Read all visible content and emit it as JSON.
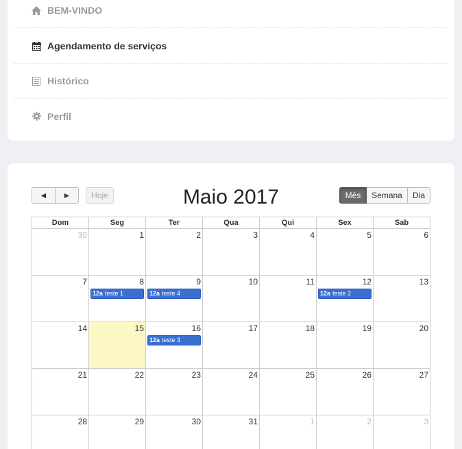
{
  "menu": {
    "items": [
      {
        "label": "BEM-VINDO",
        "icon": "home-icon"
      },
      {
        "label": "Agendamento de serviços",
        "icon": "calendar-icon"
      },
      {
        "label": "Histórico",
        "icon": "list-icon"
      },
      {
        "label": "Perfil",
        "icon": "gear-icon"
      }
    ]
  },
  "calendar": {
    "title": "Maio 2017",
    "prev_label": "◄",
    "next_label": "►",
    "today_label": "Hoje",
    "views": {
      "month": "Mês",
      "week": "Semana",
      "day": "Dia"
    },
    "weekdays": [
      "Dom",
      "Seg",
      "Ter",
      "Qua",
      "Qui",
      "Sex",
      "Sab"
    ],
    "weeks": [
      [
        {
          "n": "30",
          "other": true
        },
        {
          "n": "1"
        },
        {
          "n": "2"
        },
        {
          "n": "3"
        },
        {
          "n": "4"
        },
        {
          "n": "5"
        },
        {
          "n": "6"
        }
      ],
      [
        {
          "n": "7"
        },
        {
          "n": "8",
          "event": {
            "time": "12a",
            "title": "teste 1"
          }
        },
        {
          "n": "9",
          "event": {
            "time": "12a",
            "title": "teste 4"
          }
        },
        {
          "n": "10"
        },
        {
          "n": "11"
        },
        {
          "n": "12",
          "event": {
            "time": "12a",
            "title": "teste 2"
          }
        },
        {
          "n": "13"
        }
      ],
      [
        {
          "n": "14"
        },
        {
          "n": "15",
          "today": true
        },
        {
          "n": "16",
          "event": {
            "time": "12a",
            "title": "teste 3"
          }
        },
        {
          "n": "17"
        },
        {
          "n": "18"
        },
        {
          "n": "19"
        },
        {
          "n": "20"
        }
      ],
      [
        {
          "n": "21"
        },
        {
          "n": "22"
        },
        {
          "n": "23"
        },
        {
          "n": "24"
        },
        {
          "n": "25"
        },
        {
          "n": "26"
        },
        {
          "n": "27"
        }
      ],
      [
        {
          "n": "28"
        },
        {
          "n": "29"
        },
        {
          "n": "30"
        },
        {
          "n": "31"
        },
        {
          "n": "1",
          "other": true
        },
        {
          "n": "2",
          "other": true
        },
        {
          "n": "3",
          "other": true
        }
      ]
    ]
  }
}
